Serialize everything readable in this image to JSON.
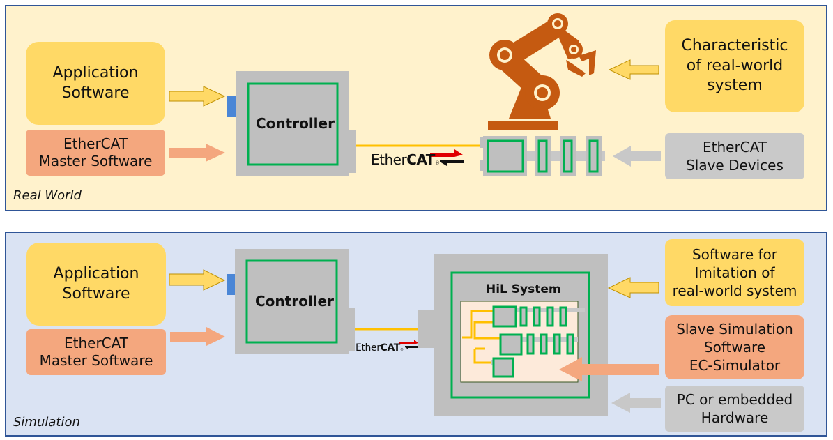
{
  "colors": {
    "real_world_bg": "#fff2cc",
    "simulation_bg": "#dae3f3",
    "panel_border": "#2f5597",
    "yellow_box": "#ffd966",
    "orange_box": "#f4a77e",
    "grey_box": "#c9c9c9",
    "device_grey": "#bfbfbf",
    "green_outline": "#00b050",
    "ethercat_cable": "#ffc000",
    "robot": "#c55a11",
    "port_blue": "#4a86d6"
  },
  "real_world": {
    "label": "Real World",
    "application_software": "Application\nSoftware",
    "master_software": "EtherCAT\nMaster Software",
    "controller_label": "Controller",
    "ethercat_logo": {
      "light": "Ether",
      "bold": "CAT",
      "mark": "®"
    },
    "characteristic_box": "Characteristic\nof real-world\nsystem",
    "slave_devices_box": "EtherCAT\nSlave Devices",
    "robot_icon": "industrial-robot-arm"
  },
  "simulation": {
    "label": "Simulation",
    "application_software": "Application\nSoftware",
    "master_software": "EtherCAT\nMaster Software",
    "controller_label": "Controller",
    "ethercat_logo": {
      "light": "Ether",
      "bold": "CAT",
      "mark": "®"
    },
    "hil_title": "HiL System",
    "imitation_box": "Software for\nImitation of\nreal-world system",
    "slave_sim_box": "Slave Simulation\nSoftware\nEC-Simulator",
    "hardware_box": "PC or embedded\nHardware"
  }
}
